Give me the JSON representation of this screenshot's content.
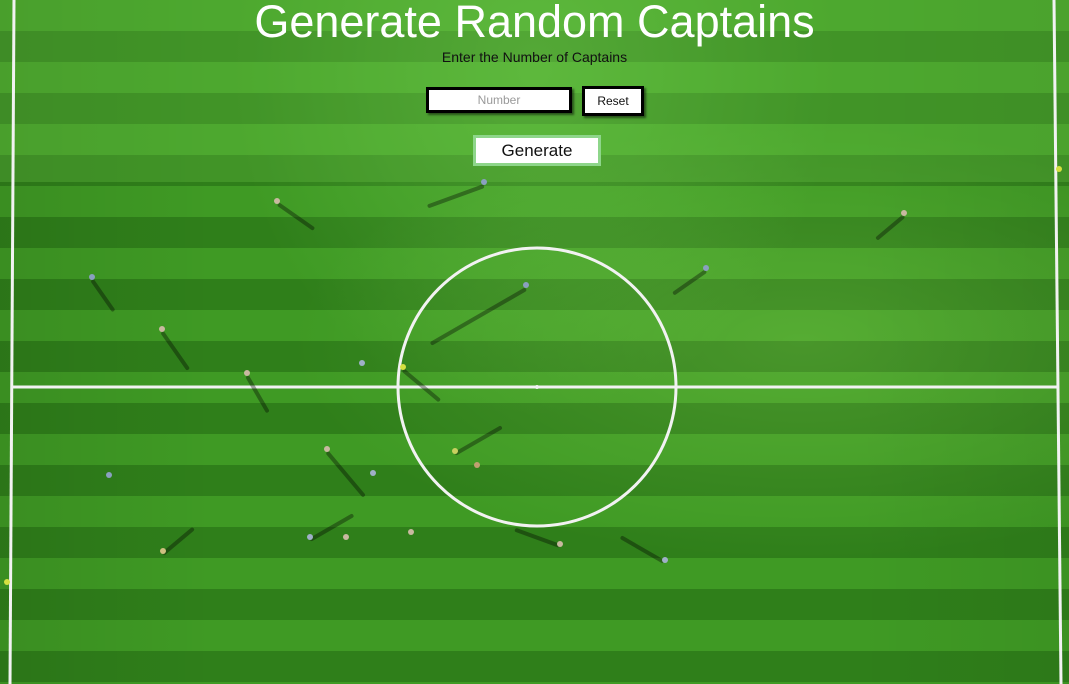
{
  "header": {
    "title": "Generate Random Captains",
    "subtitle": "Enter the Number of Captains"
  },
  "form": {
    "number_placeholder": "Number",
    "number_value": "",
    "reset_label": "Reset",
    "generate_label": "Generate"
  },
  "colors": {
    "title": "#ffffff",
    "pitch_light": "#3f9a24",
    "pitch_dark": "#2f7f1a",
    "generate_border": "#8ed68a"
  }
}
